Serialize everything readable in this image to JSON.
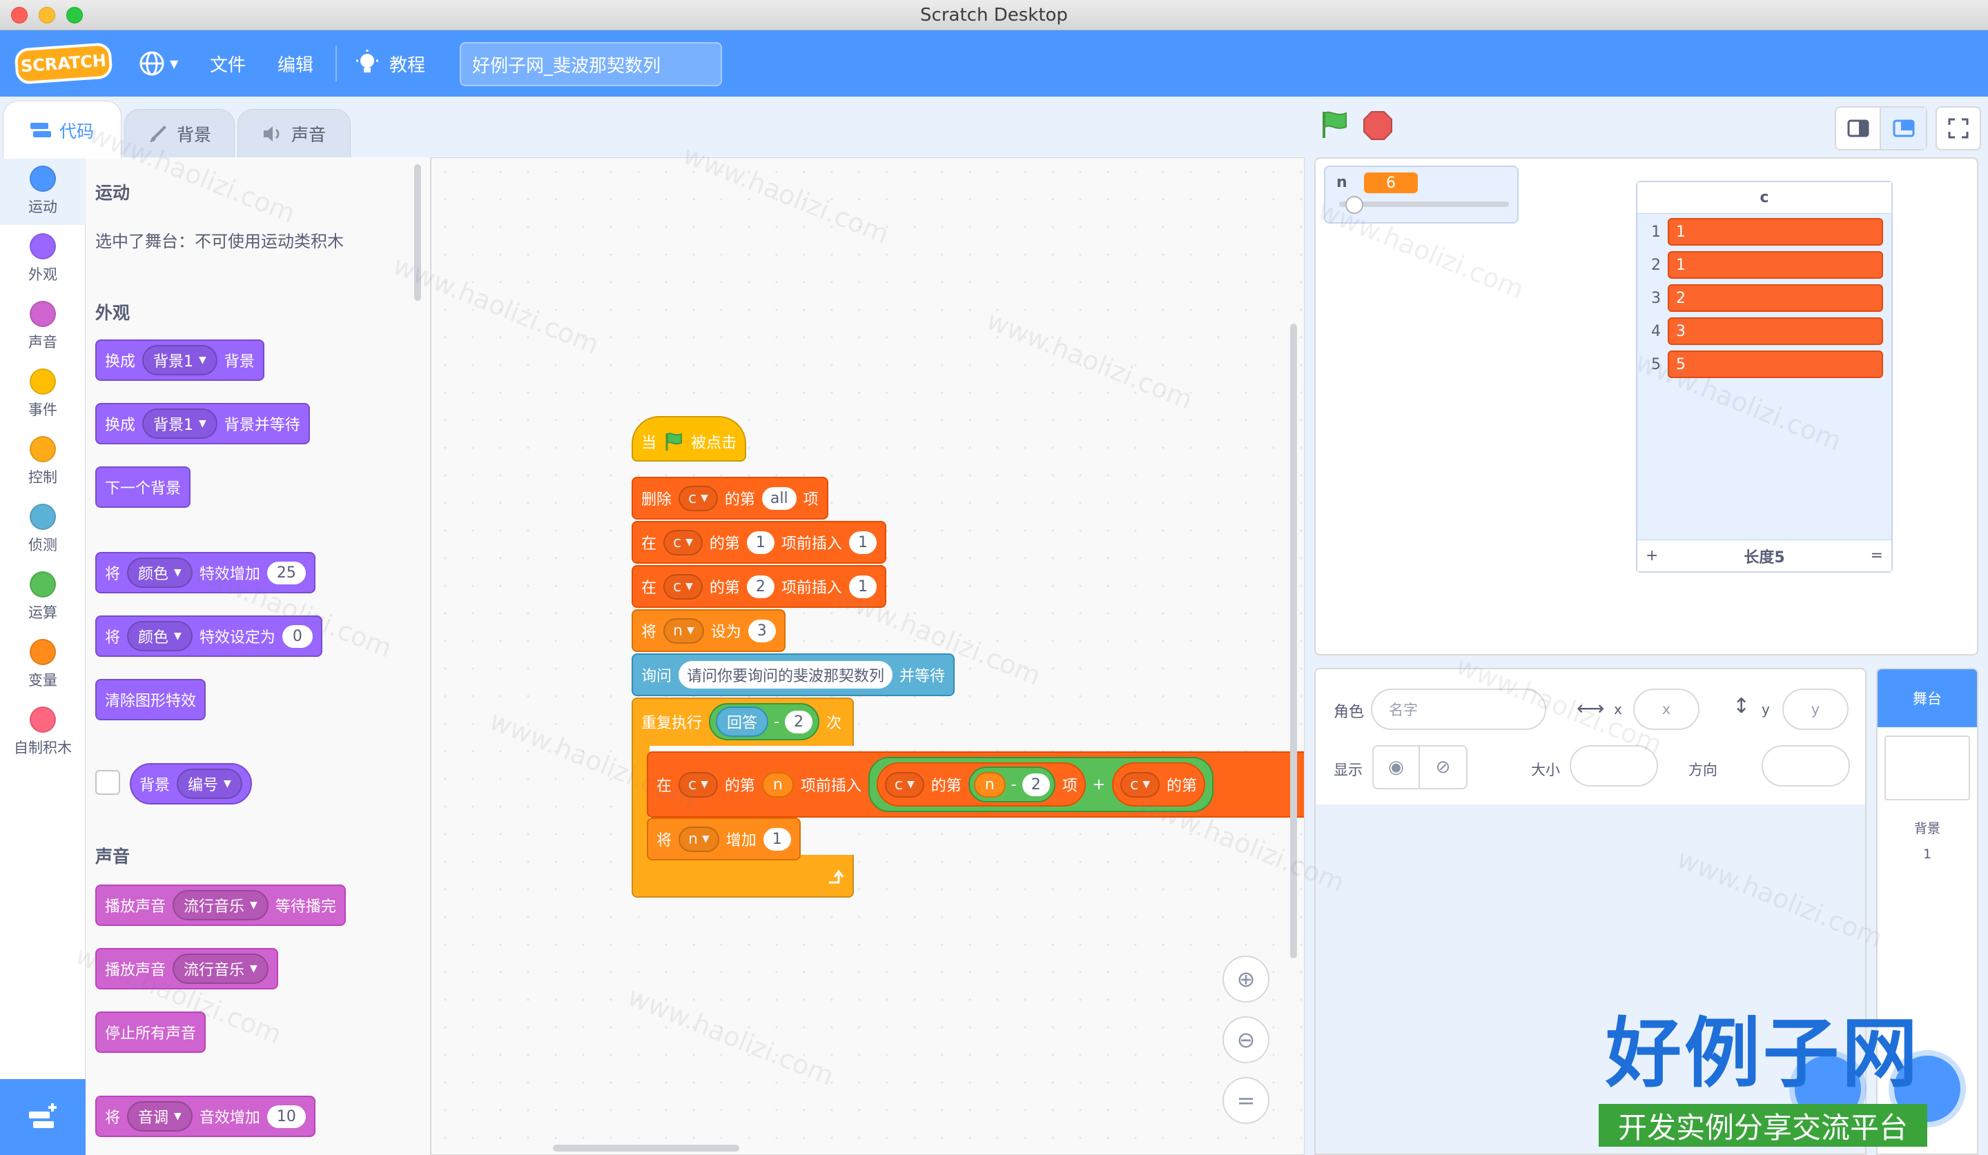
{
  "window": {
    "title": "Scratch Desktop"
  },
  "menubar": {
    "logo": "SCRATCH",
    "file": "文件",
    "edit": "编辑",
    "tutorials": "教程",
    "project_title": "好例子网_斐波那契数列"
  },
  "tabs": {
    "code": "代码",
    "backdrops": "背景",
    "sounds": "声音"
  },
  "categories": [
    {
      "label": "运动",
      "color": "#4c97ff"
    },
    {
      "label": "外观",
      "color": "#9966ff"
    },
    {
      "label": "声音",
      "color": "#cf63cf"
    },
    {
      "label": "事件",
      "color": "#ffbf00"
    },
    {
      "label": "控制",
      "color": "#ffab19"
    },
    {
      "label": "侦测",
      "color": "#5cb1d6"
    },
    {
      "label": "运算",
      "color": "#59c059"
    },
    {
      "label": "变量",
      "color": "#ff8c1a"
    },
    {
      "label": "自制积木",
      "color": "#ff6680"
    }
  ],
  "palette": {
    "motion_heading": "运动",
    "motion_note": "选中了舞台：不可使用运动类积木",
    "looks_heading": "外观",
    "switch_backdrop": "换成",
    "backdrop1": "背景1",
    "backdrop_suffix": "背景",
    "backdrop_wait_suffix": "背景并等待",
    "next_backdrop": "下一个背景",
    "set": "将",
    "color": "颜色",
    "change_effect": "特效增加",
    "change_effect_val": "25",
    "set_effect": "特效设定为",
    "set_effect_val": "0",
    "clear_effects": "清除图形特效",
    "backdrop_reporter": "背景",
    "number": "编号",
    "sound_heading": "声音",
    "play_sound": "播放声音",
    "music": "流行音乐",
    "until_done": "等待播完",
    "stop_all_sounds": "停止所有声音",
    "pitch": "音调",
    "change_sound_effect": "音效增加",
    "change_sound_effect_val": "10"
  },
  "script": {
    "when": "当",
    "clicked": "被点击",
    "delete": "删除",
    "list_c": "c",
    "of_item": "的第",
    "all": "all",
    "item": "项",
    "at": "在",
    "insert_before": "项前插入",
    "one": "1",
    "two": "2",
    "set": "将",
    "var_n": "n",
    "set_to": "设为",
    "three": "3",
    "ask": "询问",
    "question": "请问你要询问的斐波那契数列",
    "and_wait": "并等待",
    "repeat": "重复执行",
    "answer": "回答",
    "minus": "-",
    "times": "次",
    "plus": "+",
    "change_by": "增加"
  },
  "stage": {
    "var_name": "n",
    "var_value": "6",
    "slider_fraction": 0.05,
    "list_title": "c",
    "list_items": [
      "1",
      "1",
      "2",
      "3",
      "5"
    ],
    "list_length_label": "长度5",
    "list_add": "+",
    "list_resize": "="
  },
  "sprite_info": {
    "sprite_label": "角色",
    "name_placeholder": "名字",
    "x_label": "x",
    "x_placeholder": "x",
    "y_label": "y",
    "y_placeholder": "y",
    "show_label": "显示",
    "size_label": "大小",
    "direction_label": "方向"
  },
  "stage_selector": {
    "title": "舞台",
    "backdrops_label": "背景",
    "backdrops_count": "1"
  },
  "watermark": {
    "text": "www.haolizi.com",
    "brand": "好例子网",
    "slogan": "开发实例分享交流平台"
  }
}
